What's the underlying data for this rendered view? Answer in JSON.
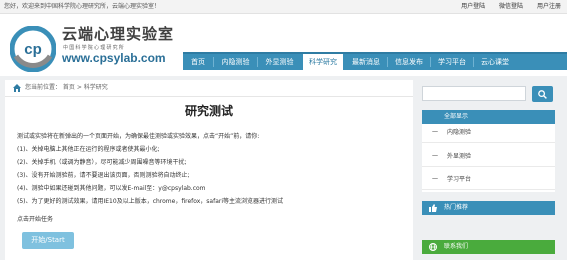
{
  "topbar": {
    "welcome": "您好，欢迎来到中国科学院心理研究所，云端心理实验室！",
    "links": [
      "用户登陆",
      "微信登陆",
      "用户注册"
    ]
  },
  "brand": {
    "title": "云端心理实验室",
    "subtitle": "中国科学院心理研究所",
    "url": "www.cpsylab.com",
    "logo_text": "cp"
  },
  "nav": {
    "items": [
      "首页",
      "内隐测验",
      "外显测验",
      "科学研究",
      "最新消息",
      "信息发布",
      "学习平台",
      "云心课堂"
    ],
    "active": "科学研究"
  },
  "breadcrumb": {
    "text": "您当前位置： 首页 > 科学研究"
  },
  "content": {
    "title": "研究测试",
    "intro": "测试或实验将在新弹出的一个页面开始，为确保最佳测验或实验效果，点击“开始”前，请你:",
    "rules": [
      "(1)、关掉电脑上其他正在运行的程序或者使其最小化;",
      "(2)、关掉手机（或调为静音），尽可能减少周围噪音等环境干扰;",
      "(3)、没有开始测验前，请不要退出该页面，否则测验将自动终止;",
      "(4)、测验中如果还碰到其他问题，可以发E-mail至：y@cpsylab.com",
      "(5)、为了更好的测试效果，请用IE10及以上版本，chrome，firefox，safari等主流浏览器进行测试"
    ],
    "click_hint": "点击开始任务",
    "start_label": "开始/Start"
  },
  "sidebar": {
    "search_placeholder": "",
    "show_all": "全部显示",
    "items": [
      "内隐测验",
      "外显测验",
      "学习平台"
    ],
    "item_marker": "一",
    "hot": "热门推荐",
    "contact": "联系我们"
  },
  "colors": {
    "nav_blue": "#3a8fb8",
    "start_button": "#7fc1df",
    "contact_green": "#4aab3d"
  }
}
